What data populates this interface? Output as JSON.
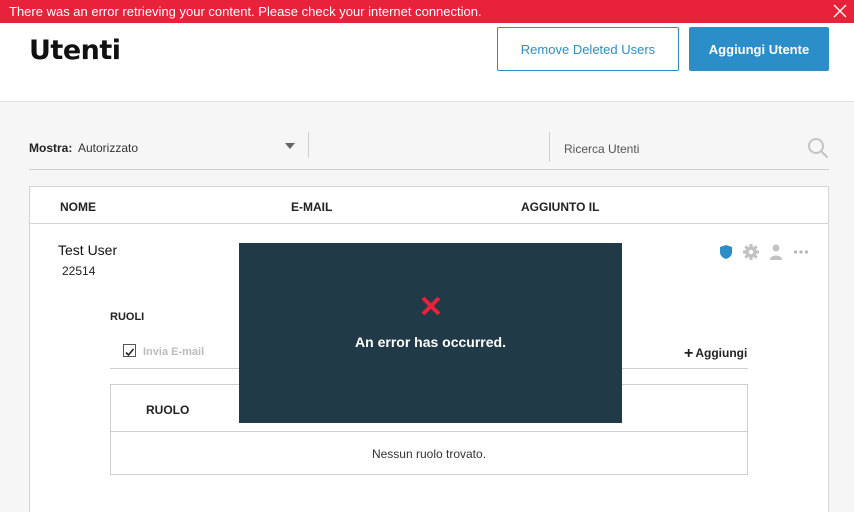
{
  "error_banner": {
    "message": "There was an error retrieving your content. Please check your internet connection.",
    "close_icon": "close-icon"
  },
  "header": {
    "title": "Utenti",
    "remove_deleted_label": "Remove Deleted Users",
    "add_user_label": "Aggiungi Utente"
  },
  "filter": {
    "label": "Mostra:",
    "selected": "Autorizzato",
    "search_placeholder": "Ricerca Utenti"
  },
  "table": {
    "columns": [
      "NOME",
      "E-MAIL",
      "AGGIUNTO IL"
    ]
  },
  "user": {
    "name": "Test User",
    "id": "22514",
    "icons": [
      "shield-icon",
      "gear-icon",
      "person-icon",
      "more-icon"
    ]
  },
  "roles": {
    "title": "RUOLI",
    "invite_label": "Invia E-mail",
    "invite_checked": true,
    "add_label": "Aggiungi",
    "column": "RUOLO",
    "empty": "Nessun ruolo trovato."
  },
  "error_modal": {
    "message": "An error has occurred."
  },
  "colors": {
    "banner": "#e8223a",
    "accent": "#2b8ec8",
    "modal": "#213a48",
    "error_x": "#e8223a"
  }
}
